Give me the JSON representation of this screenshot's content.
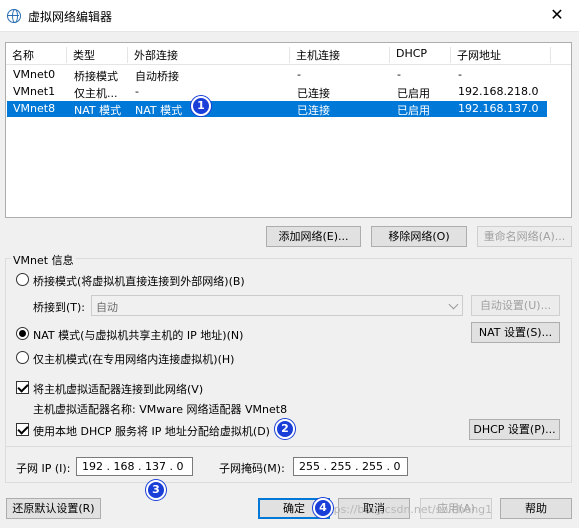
{
  "window": {
    "title": "虚拟网络编辑器",
    "close_label": "✕"
  },
  "netlist": {
    "columns": [
      "名称",
      "类型",
      "外部连接",
      "主机连接",
      "DHCP",
      "子网地址"
    ],
    "rows": [
      {
        "name": "VMnet0",
        "type": "桥接模式",
        "external": "自动桥接",
        "host": "-",
        "dhcp": "-",
        "subnet": "-"
      },
      {
        "name": "VMnet1",
        "type": "仅主机...",
        "external": "-",
        "host": "已连接",
        "dhcp": "已启用",
        "subnet": "192.168.218.0"
      },
      {
        "name": "VMnet8",
        "type": "NAT 模式",
        "external": "NAT 模式",
        "host": "已连接",
        "dhcp": "已启用",
        "subnet": "192.168.137.0"
      }
    ],
    "selected_index": 2
  },
  "list_buttons": {
    "add": "添加网络(E)...",
    "remove": "移除网络(O)",
    "rename": "重命名网络(A)..."
  },
  "vmnet_info": {
    "group_label": "VMnet 信息",
    "bridged_label": "桥接模式(将虚拟机直接连接到外部网络)(B)",
    "bridge_to_label": "桥接到(T):",
    "bridge_to_value": "自动",
    "auto_settings": "自动设置(U)...",
    "nat_label": "NAT 模式(与虚拟机共享主机的 IP 地址)(N)",
    "nat_settings": "NAT 设置(S)...",
    "hostonly_label": "仅主机模式(在专用网络内连接虚拟机)(H)",
    "connect_adapter_label": "将主机虚拟适配器连接到此网络(V)",
    "adapter_name_label": "主机虚拟适配器名称: VMware 网络适配器 VMnet8",
    "dhcp_label": "使用本地 DHCP 服务将 IP 地址分配给虚拟机(D)",
    "dhcp_settings": "DHCP 设置(P)...",
    "subnet_ip_label": "子网 IP (I):",
    "subnet_ip_value": "192 . 168 . 137 .  0",
    "subnet_mask_label": "子网掩码(M):",
    "subnet_mask_value": "255 . 255 . 255 .  0",
    "mode_selected": "nat",
    "connect_adapter_checked": true,
    "dhcp_checked": true
  },
  "footer": {
    "restore": "还原默认设置(R)",
    "ok": "确定",
    "cancel": "取消",
    "apply": "应用(A)",
    "help": "帮助"
  },
  "annotations": [
    "1",
    "2",
    "3",
    "4"
  ],
  "watermark": "https://blog.csdn.net/shicheng1"
}
